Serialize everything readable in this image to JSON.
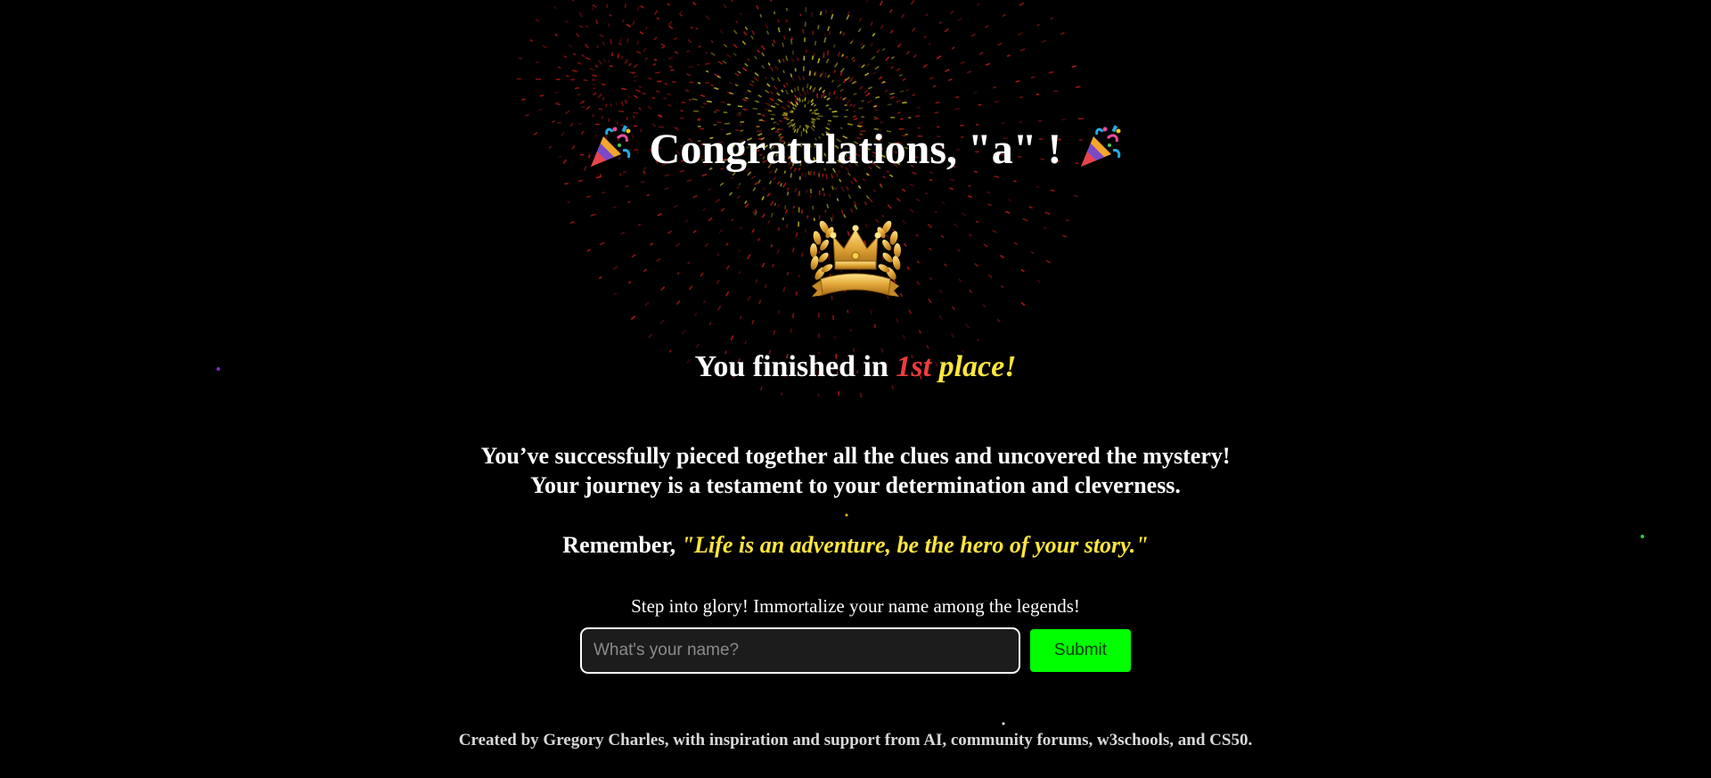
{
  "title": {
    "text": "Congratulations, \"a\" !",
    "icon": "party-popper-icon"
  },
  "crown_icon": "crown-laurel-icon",
  "place": {
    "prefix": "You finished in",
    "rank": "1st",
    "suffix": "place!",
    "colors": {
      "rank": "#ef3b3b",
      "suffix": "#ffe63b"
    }
  },
  "message": {
    "line1": "You’ve successfully pieced together all the clues and uncovered the mystery!",
    "line2": "Your journey is a testament to your determination and cleverness."
  },
  "remember": {
    "prefix": "Remember,",
    "quote": "\"Life is an adventure, be the hero of your story.\""
  },
  "leaderboard": {
    "prompt": "Step into glory! Immortalize your name among the legends!",
    "input_placeholder": "What's your name?",
    "input_value": "",
    "submit_label": "Submit",
    "submit_color": "#00ff00"
  },
  "footer": {
    "credits": "Created by Gregory Charles, with inspiration and support from AI, community forums, w3schools, and CS50."
  },
  "theme": {
    "background": "#000000",
    "text": "#ffffff",
    "accent_yellow": "#ffe63b",
    "accent_red": "#ef3b3b"
  }
}
